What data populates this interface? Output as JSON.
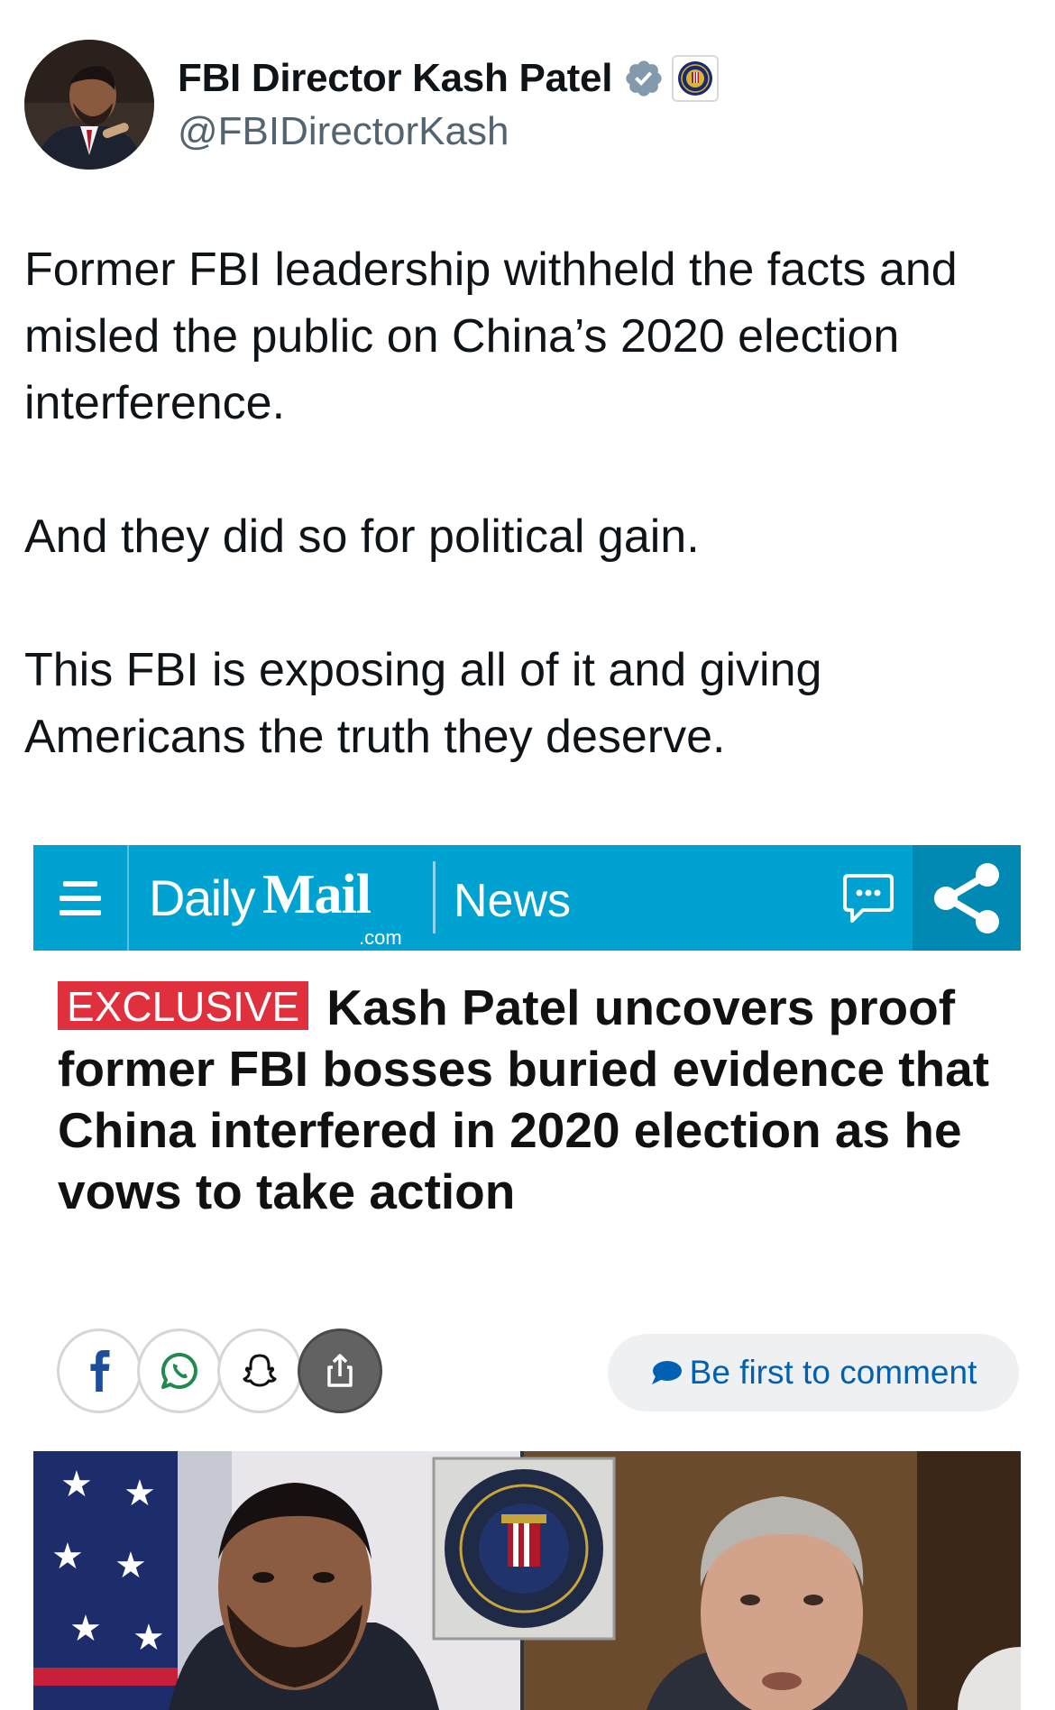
{
  "tweet": {
    "display_name": "FBI Director Kash Patel",
    "handle": "@FBIDirectorKash",
    "verified_icon": "verified-badge-icon",
    "affiliation_icon": "fbi-seal-icon",
    "paragraphs": [
      [
        "Former FBI leadership withheld the facts and",
        "misled the public on China’s 2020 election",
        "interference."
      ],
      [
        "And they did so for political gain."
      ],
      [
        "This FBI is exposing all of it and giving",
        "Americans the truth they deserve."
      ]
    ]
  },
  "card": {
    "brand_daily": "Daily",
    "brand_mail": "Mail",
    "brand_com": ".com",
    "section": "News",
    "tag": "EXCLUSIVE",
    "headline": "Kash Patel uncovers proof former FBI bosses buried evidence that China interfered in 2020 election as he vows to take action",
    "comment_cta": "Be first to comment",
    "share_buttons": [
      "facebook-icon",
      "whatsapp-icon",
      "snapchat-icon",
      "share-icon"
    ],
    "seal_text": "DEPARTMENT OF JUSTICE · FEDERAL BUREAU OF INVESTIGATION",
    "colors": {
      "bar": "#00a2d1",
      "share_bg": "#0089b3",
      "exclusive": "#e0303d",
      "cta_text": "#0061b3"
    }
  }
}
